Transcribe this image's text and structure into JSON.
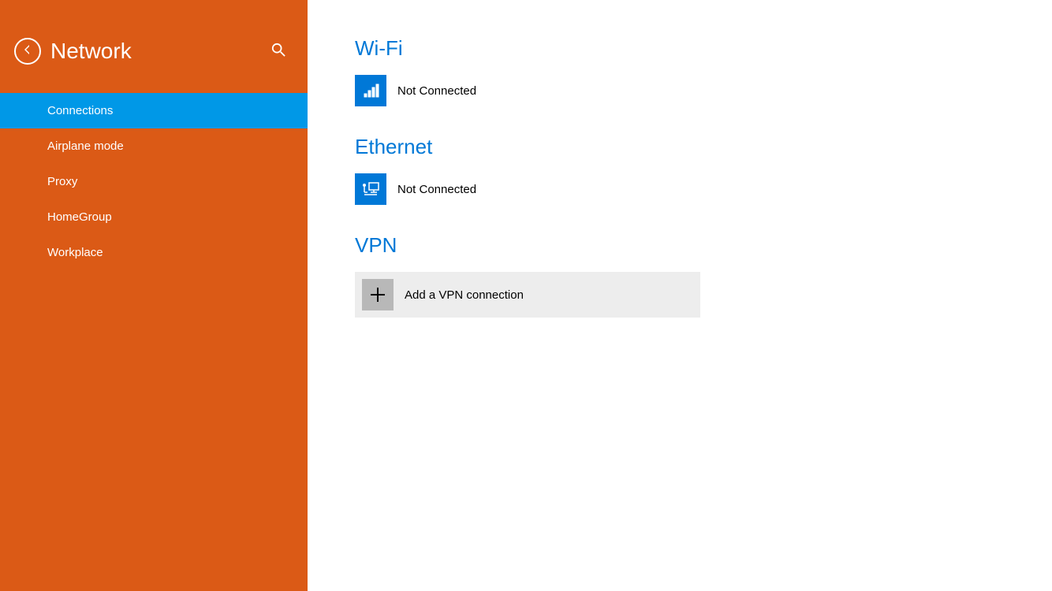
{
  "sidebar": {
    "title": "Network",
    "items": [
      {
        "label": "Connections",
        "active": true
      },
      {
        "label": "Airplane mode",
        "active": false
      },
      {
        "label": "Proxy",
        "active": false
      },
      {
        "label": "HomeGroup",
        "active": false
      },
      {
        "label": "Workplace",
        "active": false
      }
    ]
  },
  "main": {
    "wifi": {
      "heading": "Wi-Fi",
      "status": "Not Connected"
    },
    "ethernet": {
      "heading": "Ethernet",
      "status": "Not Connected"
    },
    "vpn": {
      "heading": "VPN",
      "add_label": "Add a VPN connection"
    }
  },
  "colors": {
    "sidebar_bg": "#db5a16",
    "active_item": "#0098e7",
    "accent": "#0078d7"
  }
}
